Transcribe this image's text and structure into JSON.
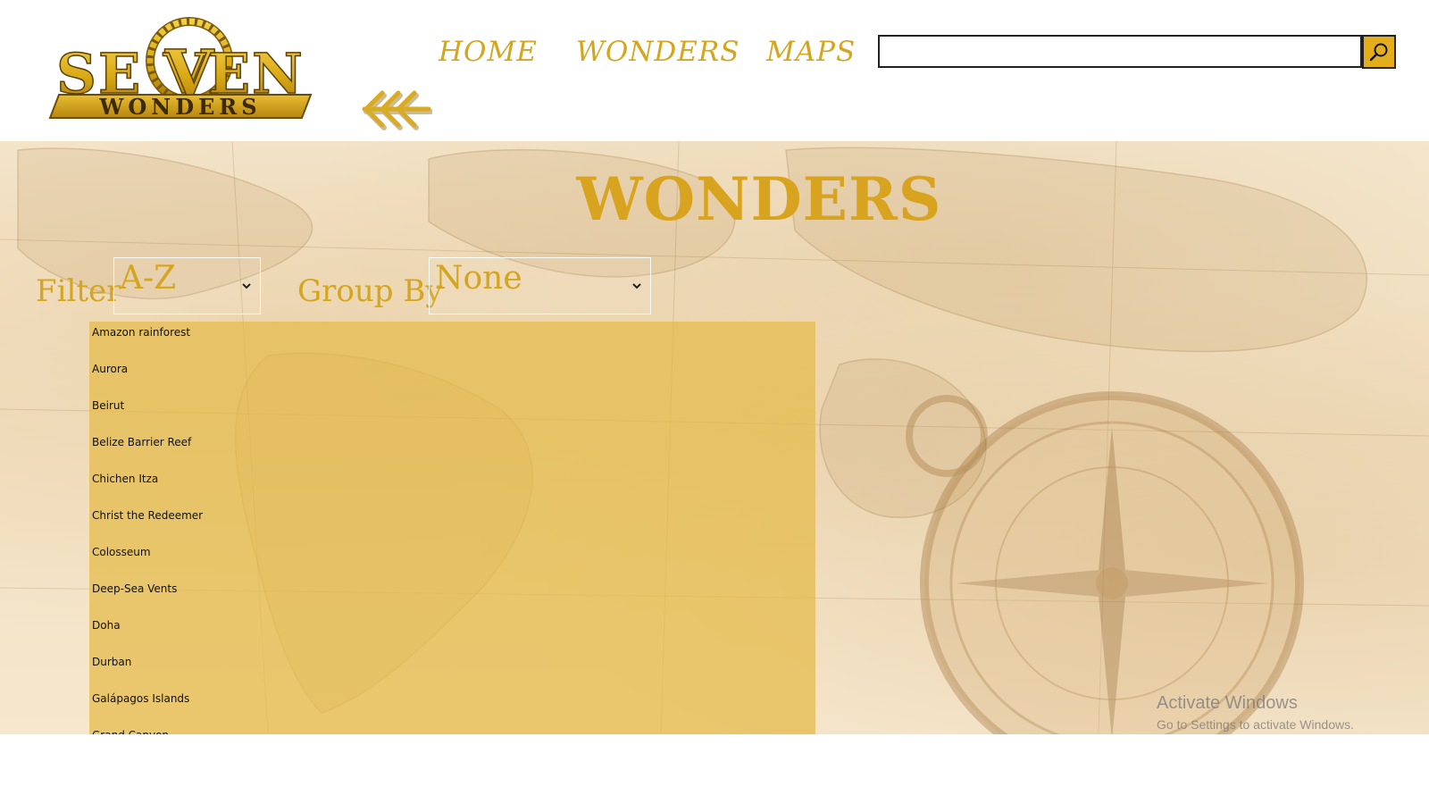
{
  "frame_counter": [
    "000",
    "002"
  ],
  "logo": {
    "text_top": "SE  VEN",
    "text_bottom": "WONDERS"
  },
  "nav": {
    "home": "HOME",
    "wonders": "WONDERS",
    "maps": "MAPS"
  },
  "search": {
    "value": "",
    "placeholder": ""
  },
  "colors": {
    "gold": "#d4a51f",
    "search_button": "#e3ad1c",
    "list_background": "#e4ba48"
  },
  "page_title": "WONDERS",
  "filter": {
    "label": "Filter",
    "selected": "A-Z"
  },
  "group_by": {
    "label": "Group By",
    "selected": "None"
  },
  "wonders": [
    "Amazon rainforest",
    "Aurora",
    "Beirut",
    "Belize Barrier Reef",
    "Chichen Itza",
    "Christ the Redeemer",
    "Colosseum",
    "Deep-Sea Vents",
    "Doha",
    "Durban",
    "Galápagos Islands",
    "Grand Canyon"
  ],
  "watermark": {
    "title": "Activate Windows",
    "subtitle": "Go to Settings to activate Windows."
  }
}
